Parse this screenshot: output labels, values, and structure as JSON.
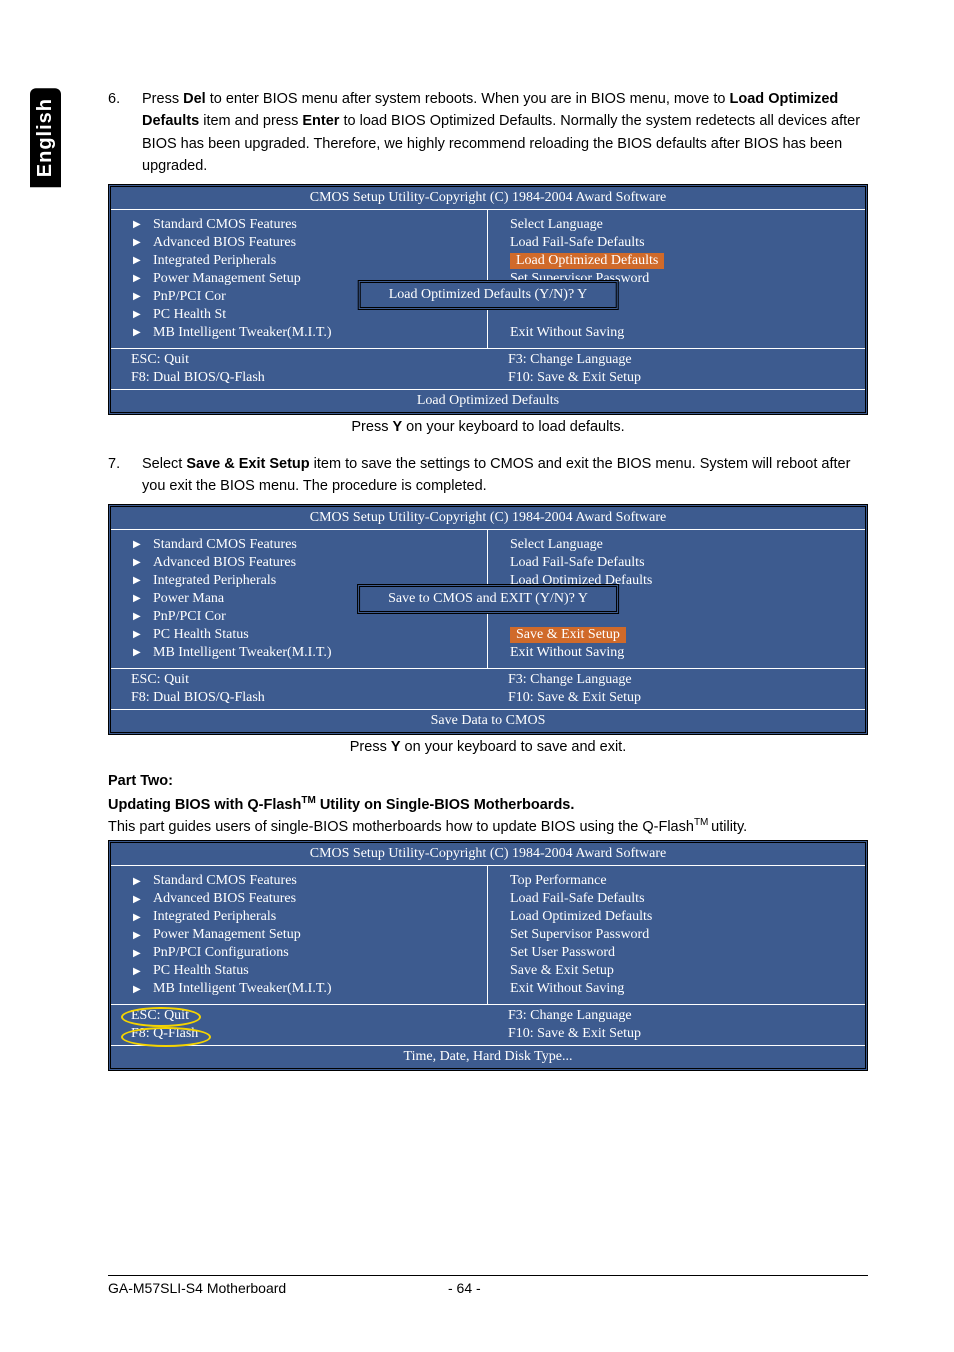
{
  "lang_tab": "English",
  "step6": {
    "num": "6.",
    "text_pre": "Press ",
    "del": "Del",
    "text_mid1": " to enter BIOS menu after system reboots. When you are in BIOS menu, move to ",
    "load_opt": "Load Optimized Defaults",
    "text_mid2": " item and press ",
    "enter": "Enter",
    "text_mid3": " to load BIOS Optimized Defaults. Normally the system redetects all devices after BIOS has been upgraded. Therefore, we highly recommend reloading the BIOS defaults after BIOS has been upgraded."
  },
  "bios_header": "CMOS Setup Utility-Copyright (C) 1984-2004 Award Software",
  "bios1": {
    "left_items": [
      "Standard CMOS Features",
      "Advanced BIOS Features",
      "Integrated Peripherals",
      "Power Management Setup",
      "PnP/PCI Cor",
      "PC Health St",
      "MB Intelligent Tweaker(M.I.T.)"
    ],
    "right_items": [
      "Select Language",
      "Load Fail-Safe Defaults",
      "Load Optimized Defaults",
      "Set Supervisor Password",
      "",
      "",
      "Exit Without Saving"
    ],
    "highlight_index": 2,
    "dialog": "Load Optimized Defaults (Y/N)? Y",
    "foot_left": [
      "ESC: Quit",
      "F8: Dual BIOS/Q-Flash"
    ],
    "foot_right": [
      "F3: Change Language",
      "F10: Save & Exit Setup"
    ],
    "status": "Load Optimized Defaults"
  },
  "caption1_pre": "Press ",
  "caption1_y": "Y",
  "caption1_post": " on your keyboard to load defaults.",
  "step7": {
    "num": "7.",
    "text_pre": "Select ",
    "save_exit": "Save & Exit Setup",
    "text_mid": " item to save the settings to CMOS and exit the BIOS menu. System will reboot after you exit the BIOS menu. The procedure is completed."
  },
  "bios2": {
    "left_items": [
      "Standard CMOS Features",
      "Advanced BIOS Features",
      "Integrated Peripherals",
      "Power Mana",
      "PnP/PCI Cor",
      "PC Health Status",
      "MB Intelligent Tweaker(M.I.T.)"
    ],
    "right_items": [
      "Select Language",
      "Load Fail-Safe Defaults",
      "Load Optimized Defaults",
      "",
      "",
      "Save & Exit Setup",
      "Exit Without Saving"
    ],
    "highlight_index": 5,
    "dialog": "Save to CMOS and EXIT (Y/N)? Y",
    "foot_left": [
      "ESC: Quit",
      "F8: Dual BIOS/Q-Flash"
    ],
    "foot_right": [
      "F3: Change Language",
      "F10: Save & Exit Setup"
    ],
    "status": "Save Data to CMOS"
  },
  "caption2_pre": "Press ",
  "caption2_y": "Y",
  "caption2_post": " on your keyboard to save and exit.",
  "part_two": "Part Two:",
  "part_two_heading_pre": "Updating BIOS with Q-Flash",
  "part_two_heading_tm": "TM",
  "part_two_heading_post": " Utility on Single-BIOS Motherboards.",
  "part_two_intro_pre": "This part guides users of single-BIOS motherboards how to update BIOS using the Q-Flash",
  "part_two_intro_tm": "TM ",
  "part_two_intro_post": "utility.",
  "bios3": {
    "left_items": [
      "Standard CMOS Features",
      "Advanced BIOS Features",
      "Integrated Peripherals",
      "Power Management Setup",
      "PnP/PCI Configurations",
      "PC Health Status",
      "MB Intelligent Tweaker(M.I.T.)"
    ],
    "right_items": [
      "Top Performance",
      "Load Fail-Safe Defaults",
      "Load Optimized Defaults",
      "Set Supervisor Password",
      "Set User Password",
      "Save & Exit Setup",
      "Exit Without Saving"
    ],
    "foot_left": [
      "ESC: Quit",
      "F8: Q-Flash"
    ],
    "foot_right": [
      "F3: Change Language",
      "F10: Save & Exit Setup"
    ],
    "status": "Time, Date, Hard Disk Type..."
  },
  "footer_model": "GA-M57SLI-S4 Motherboard",
  "footer_page": "- 64 -"
}
